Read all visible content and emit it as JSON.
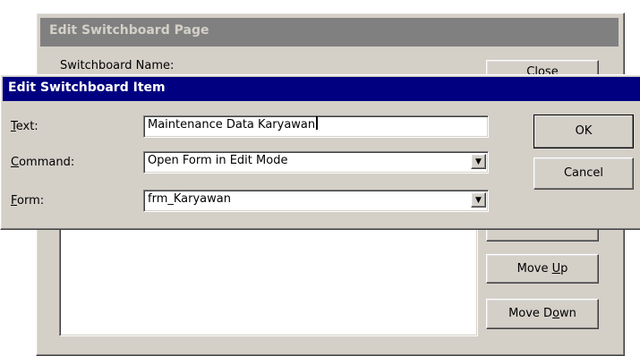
{
  "switchboard_page": {
    "title": "Edit Switchboard Page",
    "name_label": "Switchboard Name:",
    "buttons": {
      "close": "Close",
      "move_up": "Move Up",
      "move_down": "Move Down"
    }
  },
  "edit_item": {
    "title": "Edit Switchboard Item",
    "text_label": "Text:",
    "text_value": "Maintenance Data Karyawan",
    "command_label": "Command:",
    "command_value": "Open Form in Edit Mode",
    "form_label": "Form:",
    "form_value": "frm_Karyawan",
    "ok_label": "OK",
    "cancel_label": "Cancel"
  },
  "colors": {
    "active_title": "#000080",
    "inactive_title": "#808080",
    "face": "#d4d0c8"
  }
}
